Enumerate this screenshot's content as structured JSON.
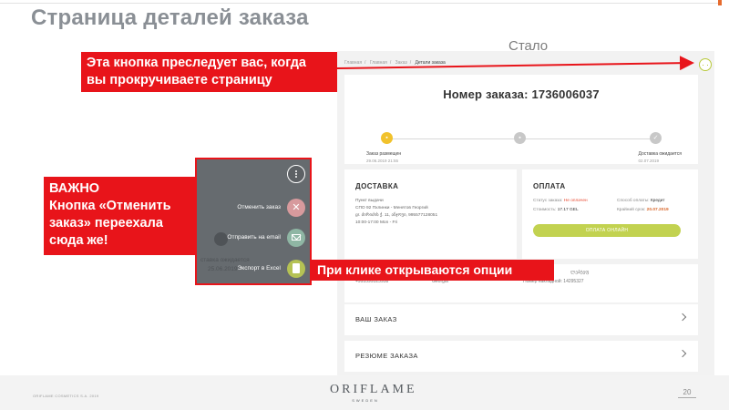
{
  "slide": {
    "title": "Страница деталей заказа",
    "stalo": "Стало",
    "footer_copyright": "ORIFLAME COSMETICS S.A. 2019",
    "logo_brand": "ORIFLAME",
    "logo_sub": "SWEDEN",
    "page_number": "20"
  },
  "mockup": {
    "breadcrumb": [
      "Главная",
      "Главная",
      "Заказ"
    ],
    "breadcrumb_current": "Детали заказа",
    "order_number": "Номер заказа: 1736006037",
    "timeline": {
      "start_label": "Заказ размещен",
      "start_date": "29.06.2019 21:55",
      "end_label": "Доставка ожидается",
      "end_date": "02.07.2019"
    },
    "delivery": {
      "title": "ДОСТАВКА",
      "lines": [
        "Пункт выдачи",
        "СПО 92 Пхлинки - Менятов Георгий",
        "gr. ძირიძის ქ. 11, ანჯოუი, 995577128051",
        "10:00-17:00 Mon - Fri"
      ]
    },
    "payment": {
      "title": "ОПЛАТА",
      "status_label": "Статус заказа:",
      "status_value": "Не оплачен",
      "method_label": "Способ оплаты:",
      "method_value": "Кредит",
      "cost_label": "Стоимость:",
      "cost_value": "17.17 GEL",
      "deadline_label": "Крайний срок:",
      "deadline_value": "20.07.2019",
      "button": "ОПЛАТА ОНЛАЙН"
    },
    "info": {
      "phone": "+995599523958",
      "country": "Georgia",
      "invoice_label": "Номер накладной:",
      "invoice_value": "14295327",
      "partial": "ლეპტეფ"
    },
    "accordion": [
      "ВАШ ЗАКАЗ",
      "РЕЗЮМЕ ЗАКАЗА"
    ]
  },
  "overlay": {
    "ghost_line1": "ставка ожидается",
    "ghost_line2": "25.06.2019",
    "actions": [
      "Отменить заказ",
      "Отправить на email",
      "Экспорт в Excel"
    ]
  },
  "callouts": {
    "top": [
      "Эта кнопка преследует вас, когда",
      "вы прокручиваете страницу"
    ],
    "left": [
      "ВАЖНО",
      "Кнопка «Отменить",
      "заказ» переехала",
      "сюда же!"
    ],
    "bottom": "При клике открываются опции"
  },
  "colors": {
    "callout_red": "#e8141a",
    "accent_green": "#c2d250",
    "title_gray": "#8a8f95"
  }
}
